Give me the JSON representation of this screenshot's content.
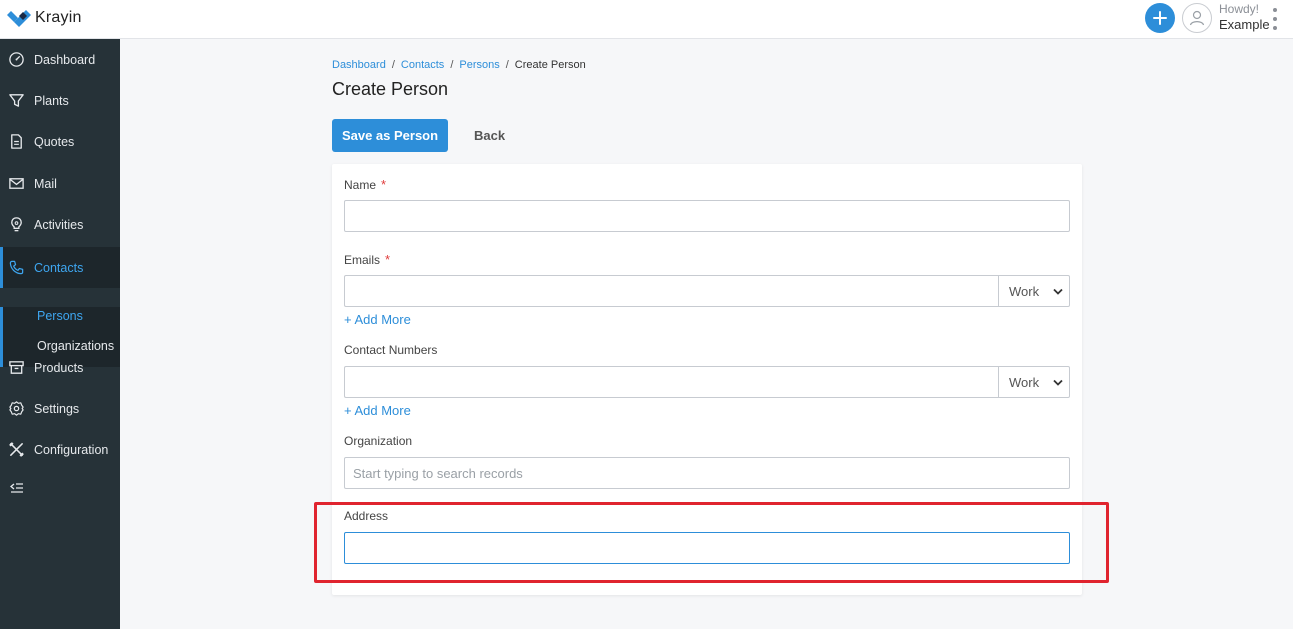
{
  "header": {
    "brand_name": "Krayin",
    "howdy": "Howdy!",
    "user_name": "Example",
    "accent_color": "#2d8ed9"
  },
  "sidebar": {
    "items": [
      {
        "label": "Dashboard",
        "icon": "dashboard-icon"
      },
      {
        "label": "Plants",
        "icon": "filter-icon"
      },
      {
        "label": "Quotes",
        "icon": "document-icon"
      },
      {
        "label": "Mail",
        "icon": "mail-icon"
      },
      {
        "label": "Activities",
        "icon": "lightbulb-icon"
      },
      {
        "label": "Contacts",
        "icon": "phone-icon",
        "active": true
      },
      {
        "label": "Products",
        "icon": "archive-icon"
      },
      {
        "label": "Settings",
        "icon": "gear-icon"
      },
      {
        "label": "Configuration",
        "icon": "tools-icon"
      }
    ],
    "sub_items": [
      {
        "label": "Persons",
        "active": true
      },
      {
        "label": "Organizations"
      }
    ]
  },
  "breadcrumb": [
    "Dashboard",
    "Contacts",
    "Persons",
    "Create Person"
  ],
  "page": {
    "title": "Create Person",
    "save_label": "Save as Person",
    "back_label": "Back"
  },
  "form": {
    "name_label": "Name",
    "emails_label": "Emails",
    "email_type": "Work",
    "add_more_label": "+ Add More",
    "contact_numbers_label": "Contact Numbers",
    "phone_type": "Work",
    "organization_label": "Organization",
    "organization_placeholder": "Start typing to search records",
    "address_label": "Address",
    "required_mark": "*"
  },
  "colors": {
    "sidebar_bg": "#263238",
    "highlight_border": "#e0242f",
    "required": "#e03b3b"
  }
}
